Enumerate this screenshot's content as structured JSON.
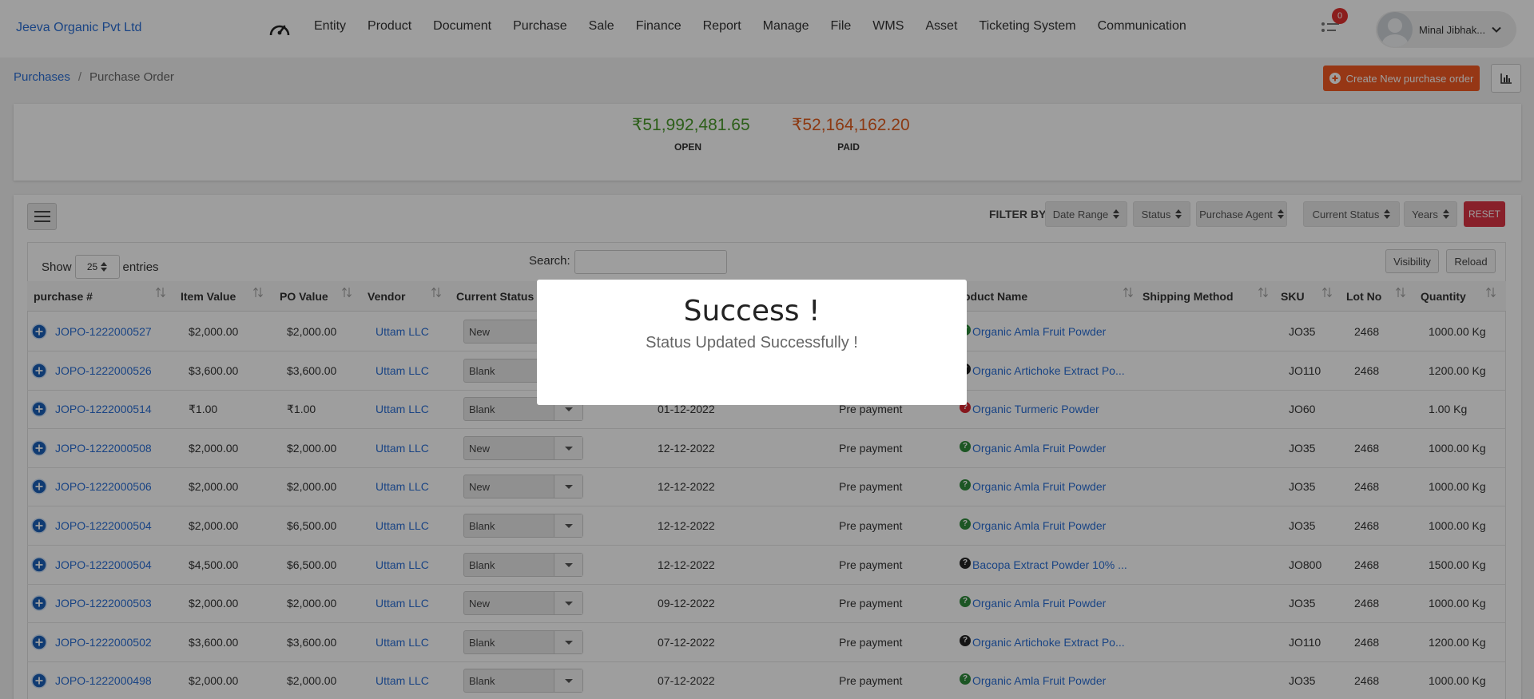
{
  "brand": "Jeeva Organic Pvt Ltd",
  "nav": [
    "Entity",
    "Product",
    "Document",
    "Purchase",
    "Sale",
    "Finance",
    "Report",
    "Manage",
    "File",
    "WMS",
    "Asset",
    "Ticketing System",
    "Communication"
  ],
  "notifications": {
    "count": "0"
  },
  "user": {
    "name": "Minal Jibhak..."
  },
  "breadcrumb": {
    "parent": "Purchases",
    "current": "Purchase Order"
  },
  "create_button": "Create New purchase order",
  "summary": {
    "open": {
      "value": "₹51,992,481.65",
      "label": "OPEN",
      "color": "#4a9a2b"
    },
    "paid": {
      "value": "₹52,164,162.20",
      "label": "PAID",
      "color": "#e25d1e"
    }
  },
  "filters": {
    "label": "FILTER BY:",
    "items": [
      "Date Range",
      "Status",
      "Purchase Agent",
      "Current Status",
      "Years"
    ],
    "reset": "RESET"
  },
  "table_controls": {
    "show": "Show",
    "entries_value": "25",
    "entries": "entries",
    "search": "Search:",
    "visibility": "Visibility",
    "reload": "Reload"
  },
  "columns": [
    "purchase #",
    "Item Value",
    "PO Value",
    "Vendor",
    "Current Status",
    "oduct Name",
    "Shipping Method",
    "SKU",
    "Lot No",
    "Quantity"
  ],
  "rows": [
    {
      "po": "JOPO-1222000527",
      "item": "$2,000.00",
      "poval": "$2,000.00",
      "vendor": "Uttam LLC",
      "status": "New",
      "date": "",
      "pay": "",
      "icon": "green",
      "product": "Organic Amla Fruit Powder",
      "sku": "JO35",
      "lot": "2468",
      "qty": "1000.00 Kg"
    },
    {
      "po": "JOPO-1222000526",
      "item": "$3,600.00",
      "poval": "$3,600.00",
      "vendor": "Uttam LLC",
      "status": "Blank",
      "date": "",
      "pay": "",
      "icon": "black",
      "product": "Organic Artichoke Extract Po...",
      "sku": "JO110",
      "lot": "2468",
      "qty": "1200.00 Kg"
    },
    {
      "po": "JOPO-1222000514",
      "item": "₹1.00",
      "poval": "₹1.00",
      "vendor": "Uttam LLC",
      "status": "Blank",
      "date": "01-12-2022",
      "pay": "Pre payment",
      "icon": "red",
      "product": "Organic Turmeric Powder",
      "sku": "JO60",
      "lot": "",
      "qty": "1.00 Kg"
    },
    {
      "po": "JOPO-1222000508",
      "item": "$2,000.00",
      "poval": "$2,000.00",
      "vendor": "Uttam LLC",
      "status": "New",
      "date": "12-12-2022",
      "pay": "Pre payment",
      "icon": "green",
      "product": "Organic Amla Fruit Powder",
      "sku": "JO35",
      "lot": "2468",
      "qty": "1000.00 Kg"
    },
    {
      "po": "JOPO-1222000506",
      "item": "$2,000.00",
      "poval": "$2,000.00",
      "vendor": "Uttam LLC",
      "status": "New",
      "date": "12-12-2022",
      "pay": "Pre payment",
      "icon": "green",
      "product": "Organic Amla Fruit Powder",
      "sku": "JO35",
      "lot": "2468",
      "qty": "1000.00 Kg"
    },
    {
      "po": "JOPO-1222000504",
      "item": "$2,000.00",
      "poval": "$6,500.00",
      "vendor": "Uttam LLC",
      "status": "Blank",
      "date": "12-12-2022",
      "pay": "Pre payment",
      "icon": "green",
      "product": "Organic Amla Fruit Powder",
      "sku": "JO35",
      "lot": "2468",
      "qty": "1000.00 Kg"
    },
    {
      "po": "JOPO-1222000504",
      "item": "$4,500.00",
      "poval": "$6,500.00",
      "vendor": "Uttam LLC",
      "status": "Blank",
      "date": "12-12-2022",
      "pay": "Pre payment",
      "icon": "black",
      "product": "Bacopa Extract Powder 10% ...",
      "sku": "JO800",
      "lot": "2468",
      "qty": "1500.00 Kg"
    },
    {
      "po": "JOPO-1222000503",
      "item": "$2,000.00",
      "poval": "$2,000.00",
      "vendor": "Uttam LLC",
      "status": "New",
      "date": "09-12-2022",
      "pay": "Pre payment",
      "icon": "green",
      "product": "Organic Amla Fruit Powder",
      "sku": "JO35",
      "lot": "2468",
      "qty": "1000.00 Kg"
    },
    {
      "po": "JOPO-1222000502",
      "item": "$3,600.00",
      "poval": "$3,600.00",
      "vendor": "Uttam LLC",
      "status": "Blank",
      "date": "07-12-2022",
      "pay": "Pre payment",
      "icon": "black",
      "product": "Organic Artichoke Extract Po...",
      "sku": "JO110",
      "lot": "2468",
      "qty": "1200.00 Kg"
    },
    {
      "po": "JOPO-1222000498",
      "item": "$2,000.00",
      "poval": "$2,000.00",
      "vendor": "Uttam LLC",
      "status": "Blank",
      "date": "07-12-2022",
      "pay": "Pre payment",
      "icon": "green",
      "product": "Organic Amla Fruit Powder",
      "sku": "JO35",
      "lot": "2468",
      "qty": "1000.00 Kg"
    }
  ],
  "modal": {
    "title": "Success !",
    "message": "Status Updated Successfully !"
  }
}
